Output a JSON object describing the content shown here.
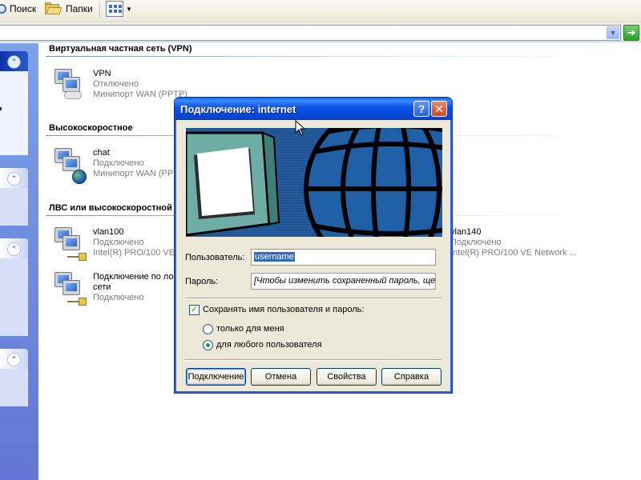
{
  "toolbar": {
    "search_label": "Поиск",
    "folders_label": "Папки",
    "search_icon": "search-icon",
    "folders_icon": "folder-icon",
    "views_icon": "views-icon"
  },
  "groups": [
    {
      "title": "Виртуальная частная сеть (VPN)",
      "items": [
        {
          "name": "VPN",
          "status": "Отключено",
          "device": "Минипорт WAN (PPTP)"
        }
      ]
    },
    {
      "title": "Высокоскоростное",
      "items": [
        {
          "name": "chat",
          "status": "Подключено",
          "device": "Минипорт WAN (PPPOE)"
        }
      ]
    },
    {
      "title": "ЛВС или высокоскоростной Интернет",
      "items": [
        {
          "name": "vlan100",
          "status": "Подключено",
          "device": "Intel(R) PRO/100 VE Network Connection"
        },
        {
          "name": "vlan140",
          "status": "Подключено",
          "device": "Intel(R) PRO/100 VE Network ..."
        },
        {
          "name": "Подключение по локальной",
          "name2": "сети",
          "status": "Подключено"
        }
      ]
    }
  ],
  "dialog": {
    "title": "Подключение: internet",
    "user_label": "Пользователь:",
    "user_value": "username",
    "password_label": "Пароль:",
    "password_value": "[Чтобы изменить сохраненный пароль, ще.",
    "save_checkbox_label": "Сохранять имя пользователя и пароль:",
    "save_checked": true,
    "radio_me_label": "только для меня",
    "radio_any_label": "для любого пользователя",
    "radio_selected": "any",
    "buttons": {
      "connect": "Подключение",
      "cancel": "Отмена",
      "properties": "Свойства",
      "help": "Справка"
    }
  },
  "colors": {
    "title_bar": "#0a52e6",
    "banner_bg": "#1c5a9f",
    "task_pane": "#7ba2e7"
  }
}
